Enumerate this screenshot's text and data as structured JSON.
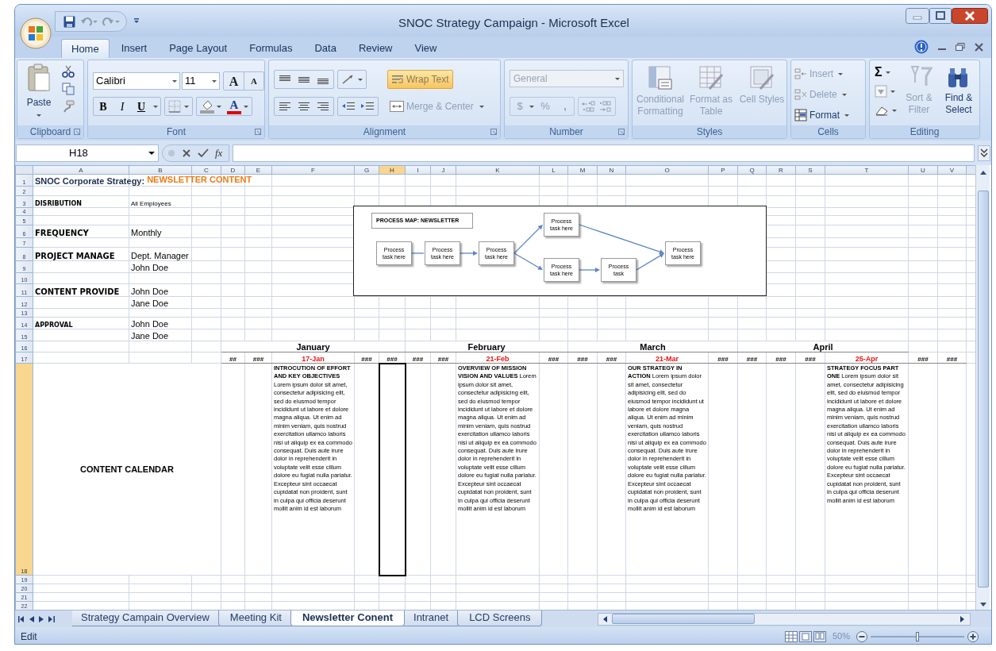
{
  "window": {
    "title": "SNOC Strategy Campaign - Microsoft Excel"
  },
  "ribbon_tabs": [
    {
      "label": "Home",
      "selected": true
    },
    {
      "label": "Insert",
      "selected": false
    },
    {
      "label": "Page Layout",
      "selected": false
    },
    {
      "label": "Formulas",
      "selected": false
    },
    {
      "label": "Data",
      "selected": false
    },
    {
      "label": "Review",
      "selected": false
    },
    {
      "label": "View",
      "selected": false
    }
  ],
  "clipboard": {
    "label": "Clipboard",
    "paste": "Paste"
  },
  "font": {
    "label": "Font",
    "name": "Calibri",
    "size": "11",
    "grow": "A",
    "shrink": "A",
    "bold": "B",
    "italic": "I",
    "underline": "U",
    "color_glyph": "A"
  },
  "alignment": {
    "label": "Alignment",
    "wrap_text": {
      "label": "Wrap Text",
      "on": true
    },
    "merge": {
      "label": "Merge & Center",
      "disabled": true
    }
  },
  "number": {
    "label": "Number",
    "format": "General",
    "currency": "$",
    "percent": "%",
    "comma": ",",
    "disabled": true
  },
  "styles": {
    "label": "Styles",
    "buttons": [
      {
        "label": "Conditional Formatting",
        "disabled": true
      },
      {
        "label": "Format as Table",
        "disabled": true
      },
      {
        "label": "Cell Styles",
        "disabled": true
      }
    ]
  },
  "cells": {
    "label": "Cells",
    "buttons": [
      {
        "label": "Insert",
        "disabled": true
      },
      {
        "label": "Delete",
        "disabled": true
      },
      {
        "label": "Format",
        "disabled": false
      }
    ]
  },
  "editing": {
    "label": "Editing",
    "sum": "Σ",
    "buttons": [
      {
        "label": "Sort & Filter",
        "disabled": true
      },
      {
        "label": "Find & Select",
        "disabled": false
      }
    ]
  },
  "formula_bar": {
    "cell": "H18",
    "function_label": "fx"
  },
  "columns": [
    {
      "label": "A",
      "selected": false
    },
    {
      "label": "B",
      "selected": false
    },
    {
      "label": "C",
      "selected": false
    },
    {
      "label": "D",
      "selected": false
    },
    {
      "label": "E",
      "selected": false
    },
    {
      "label": "F",
      "selected": false
    },
    {
      "label": "G",
      "selected": false
    },
    {
      "label": "H",
      "selected": true
    },
    {
      "label": "I",
      "selected": false
    },
    {
      "label": "J",
      "selected": false
    },
    {
      "label": "K",
      "selected": false
    },
    {
      "label": "L",
      "selected": false
    },
    {
      "label": "M",
      "selected": false
    },
    {
      "label": "N",
      "selected": false
    },
    {
      "label": "O",
      "selected": false
    },
    {
      "label": "P",
      "selected": false
    },
    {
      "label": "Q",
      "selected": false
    },
    {
      "label": "R",
      "selected": false
    },
    {
      "label": "S",
      "selected": false
    },
    {
      "label": "T",
      "selected": false
    },
    {
      "label": "U",
      "selected": false
    },
    {
      "label": "V",
      "selected": false
    }
  ],
  "rows": [
    {
      "number": "1",
      "selected": false,
      "cells": {
        "A": {
          "kind": "title",
          "text": "SNOC Corporate Strategy:",
          "accent": "NEWSLETTER CONTENT"
        }
      }
    },
    {
      "number": "2",
      "selected": false
    },
    {
      "number": "3",
      "selected": false,
      "cells": {
        "A": {
          "kind": "label-small",
          "text": "DISRIBUTION"
        },
        "B": {
          "kind": "value-small",
          "text": "All Employees"
        }
      }
    },
    {
      "number": "4",
      "selected": false
    },
    {
      "number": "5",
      "selected": false
    },
    {
      "number": "6",
      "selected": false,
      "cells": {
        "A": {
          "kind": "label-large",
          "text": "FREQUENCY"
        },
        "B": {
          "kind": "value",
          "text": "Monthly"
        }
      }
    },
    {
      "number": "7",
      "selected": false
    },
    {
      "number": "8",
      "selected": false,
      "cells": {
        "A": {
          "kind": "label-large",
          "text": "PROJECT MANAGE"
        },
        "B": {
          "kind": "value",
          "text": "Dept. Manager"
        }
      }
    },
    {
      "number": "9",
      "selected": false,
      "cells": {
        "B": {
          "kind": "value",
          "text": "John Doe"
        }
      }
    },
    {
      "number": "10",
      "selected": false
    },
    {
      "number": "11",
      "selected": false,
      "cells": {
        "A": {
          "kind": "label-large",
          "text": "CONTENT PROVIDE"
        },
        "B": {
          "kind": "value",
          "text": "John Doe"
        }
      }
    },
    {
      "number": "12",
      "selected": false,
      "cells": {
        "B": {
          "kind": "value",
          "text": "Jane Doe"
        }
      }
    },
    {
      "number": "13",
      "selected": false
    },
    {
      "number": "14",
      "selected": false,
      "cells": {
        "A": {
          "kind": "label-small",
          "text": "APPROVAL"
        },
        "B": {
          "kind": "value",
          "text": "John Doe"
        }
      }
    },
    {
      "number": "15",
      "selected": false,
      "cells": {
        "B": {
          "kind": "value",
          "text": "Jane Doe"
        }
      }
    },
    {
      "number": "16",
      "selected": false,
      "cells": {
        "D": {
          "kind": "month",
          "text": "January"
        },
        "I": {
          "kind": "month",
          "text": "February"
        },
        "M": {
          "kind": "month",
          "text": "March"
        },
        "Q": {
          "kind": "month",
          "text": "April"
        }
      }
    },
    {
      "number": "17",
      "selected": false,
      "cells": {
        "D": {
          "kind": "hash",
          "text": "##"
        },
        "E": {
          "kind": "hash",
          "text": "###"
        },
        "F": {
          "kind": "date",
          "text": "17-Jan"
        },
        "G": {
          "kind": "hash",
          "text": "###"
        },
        "H": {
          "kind": "hash",
          "text": "###"
        },
        "I": {
          "kind": "hash",
          "text": "###"
        },
        "J": {
          "kind": "hash",
          "text": "###"
        },
        "K": {
          "kind": "date",
          "text": "21-Feb"
        },
        "L": {
          "kind": "hash",
          "text": "###"
        },
        "M": {
          "kind": "hash",
          "text": "###"
        },
        "N": {
          "kind": "hash",
          "text": "###"
        },
        "O": {
          "kind": "date",
          "text": "21-Mar"
        },
        "P": {
          "kind": "hash",
          "text": "###"
        },
        "Q": {
          "kind": "hash",
          "text": "###"
        },
        "R": {
          "kind": "hash",
          "text": "###"
        },
        "S": {
          "kind": "hash",
          "text": "###"
        },
        "T": {
          "kind": "date",
          "text": "25-Apr"
        },
        "U": {
          "kind": "hash",
          "text": "###"
        },
        "V": {
          "kind": "hash",
          "text": "###"
        }
      }
    },
    {
      "number": "18",
      "selected": true,
      "cells": {
        "A": {
          "kind": "section",
          "text": "CONTENT CALENDAR"
        },
        "F": {
          "kind": "article",
          "text": "**INTROCUTION OF EFFORT AND KEY OBJECTIVES** Lorem ipsum dolor sit amet, consectetur adipisicing elit, sed do eiusmod tempor incididunt ut labore et dolore magna aliqua. Ut enim ad minim veniam, quis nostrud exercitation ullamco laboris nisi ut aliquip ex ea commodo consequat. Duis aute irure dolor in reprehenderit in voluptate velit esse cillum dolore eu fugiat nulla pariatur. Excepteur sint occaecat cupidatat non proident, sunt in culpa qui officia deserunt mollit anim id est laborum"
        },
        "K": {
          "kind": "article",
          "text": "**OVERVIEW OF MISSION VISION AND VALUES** Lorem ipsum dolor sit amet, consectetur adipisicing elit, sed do eiusmod tempor incididunt ut labore et dolore magna aliqua. Ut enim ad minim veniam, quis nostrud exercitation ullamco laboris nisi ut aliquip ex ea commodo consequat. Duis aute irure dolor in reprehenderit in voluptate velit esse cillum dolore eu fugiat nulla pariatur. Excepteur sint occaecat cupidatat non proident, sunt in culpa qui officia deserunt mollit anim id est laborum"
        },
        "O": {
          "kind": "article",
          "text": "**OUR STRATEGY IN ACTION** Lorem ipsum dolor sit amet, consectetur adipisicing elit, sed do eiusmod tempor incididunt ut labore et dolore magna aliqua. Ut enim ad minim veniam, quis nostrud exercitation ullamco laboris nisi ut aliquip ex ea commodo consequat. Duis aute irure dolor in reprehenderit in voluptate velit esse cillum dolore eu fugiat nulla pariatur. Excepteur sint occaecat cupidatat non proident, sunt in culpa qui officia deserunt mollit anim id est laborum"
        },
        "T": {
          "kind": "article",
          "text": "**STRATEGY FOCUS PART ONE** Lorem ipsum dolor sit amet, consectetur adipisicing elit, sed do eiusmod tempor incididunt ut labore et dolore magna aliqua. Ut enim ad minim veniam, quis nostrud exercitation ullamco laboris nisi ut aliquip ex ea commodo consequat. Duis aute irure dolor in reprehenderit in voluptate velit esse cillum dolore eu fugiat nulla pariatur. Excepteur sint occaecat cupidatat non proident, sunt in culpa qui officia deserunt mollit anim id est laborum"
        }
      }
    },
    {
      "number": "19",
      "selected": false
    },
    {
      "number": "20",
      "selected": false
    },
    {
      "number": "21",
      "selected": false
    },
    {
      "number": "22",
      "selected": false
    }
  ],
  "process_map": {
    "title": "PROCESS MAP: NEWSLETTER",
    "nodes": [
      {
        "label": "Process task here"
      },
      {
        "label": "Process task here"
      },
      {
        "label": "Process task here"
      },
      {
        "label": "Process task here"
      },
      {
        "label": "Process task here"
      },
      {
        "label": "Process task"
      },
      {
        "label": "Process task here"
      }
    ]
  },
  "sheet_tabs": [
    {
      "label": "Strategy Campain Overview",
      "selected": false
    },
    {
      "label": "Meeting Kit",
      "selected": false
    },
    {
      "label": "Newsletter Conent",
      "selected": true
    },
    {
      "label": "Intranet",
      "selected": false
    },
    {
      "label": "LCD Screens",
      "selected": false
    }
  ],
  "status_bar": {
    "mode": "Edit",
    "zoom": "50%",
    "zoom_slider": {
      "level": 0.5
    }
  }
}
